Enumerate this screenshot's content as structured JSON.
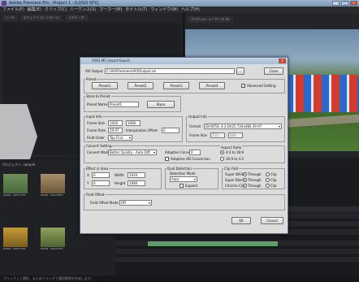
{
  "window": {
    "title": "Adobe Premiere Pro - Project 1 - [LOGO SFX]"
  },
  "menu": [
    "ファイル(F)",
    "編集(E)",
    "クリップ(C)",
    "シーケンス(S)",
    "マーカー(M)",
    "タイトル(T)",
    "ウィンドウ(W)",
    "ヘルプ(H)"
  ],
  "left_panel": {
    "tabs": [
      "ソース",
      "エフェクトコントロール",
      "メタデータ"
    ]
  },
  "monitor": {
    "tabs": [
      "プログラム: シーケンス 01"
    ]
  },
  "project": {
    "tab": "プロジェクト: sample",
    "thumbs": [
      {
        "label": "P0001 - 0001.MTS",
        "color": "#6f8e5a"
      },
      {
        "label": "P0002 - 0002.MTS",
        "color": "#a88e6c"
      },
      {
        "label": "P0003 - 0003.MTS",
        "color": "#c49b3a"
      },
      {
        "label": "P0004 - 0004.MTS",
        "color": "#8fa15f"
      }
    ]
  },
  "statusbar": "クリックして選択、またはドラッグで選択範囲を作成します。",
  "dialog": {
    "title": "FDK2 MC Import Export",
    "avi_output_label": "AVI Output",
    "avi_output_value": "C:\\AVI\\Premiere\\AVI\\Output.avi",
    "browse": "...",
    "close": "Close",
    "preset_label": "Preset",
    "presets": [
      "Preset1",
      "Preset2",
      "Preset3",
      "Preset4"
    ],
    "advanced_setting": "Advanced Setting",
    "store_preset_label": "Store to Preset",
    "preset_name_label": "Preset Name",
    "preset_name_value": "Preset1",
    "store": "Store",
    "input_info_label": "Input Info",
    "frame_size_label": "Frame Size",
    "frame_w": "1920",
    "frame_h": "1080",
    "frame_rate_label": "Frame Rate",
    "frame_rate_value": "29.97",
    "interpolation_label": "Interpolation Offset",
    "interpolation_value": "0",
    "field_order_label": "Field Order",
    "field_order_value": "Top First",
    "output_info_label": "Output Info",
    "format_label": "Format",
    "format_value": "DV-NTSC 4:3 DV25 720x480 29.97",
    "frame_size_out_label": "Frame Size",
    "frame_size_out_value": "720",
    "frame_size_out_h": "480",
    "convert_setting_label": "Convert Setting",
    "convert_mode_label": "Convert Mode",
    "convert_mode_value": "Better Quality - Auto Diff",
    "adaptive_label": "Adaptive Convert",
    "adaptive_value": "0",
    "aspect_ratio_label": "Aspect Ratio",
    "ar_radio_1": "4:3 to 16:9",
    "ar_radio_2": "16:9 to 4:3",
    "adaptive_hd_label": "Adaptive HD Conversion",
    "effect_area_label": "Effect in Area",
    "x_label": "X",
    "x_value": "0",
    "y_label": "Y",
    "y_value": "0",
    "width_label": "Width",
    "width_value": "1920",
    "height_label": "Height",
    "height_value": "1080",
    "dual_detection_label": "Dual Detection",
    "detection_mode_label": "Detection Mode",
    "detection_mode_value": "Auto",
    "expand_label": "Expand",
    "clip_fold_label": "Clip Fold",
    "super_white": "Super White",
    "super_black": "Super Black",
    "chroma_clip": "Chroma Clip",
    "through": "Through",
    "clip": "Clip",
    "field_offset_label": "Field Offset",
    "field_offset_mode_label": "Field Offset Mode",
    "field_offset_mode_value": "Off",
    "ok": "OK",
    "cancel": "Cancel"
  }
}
